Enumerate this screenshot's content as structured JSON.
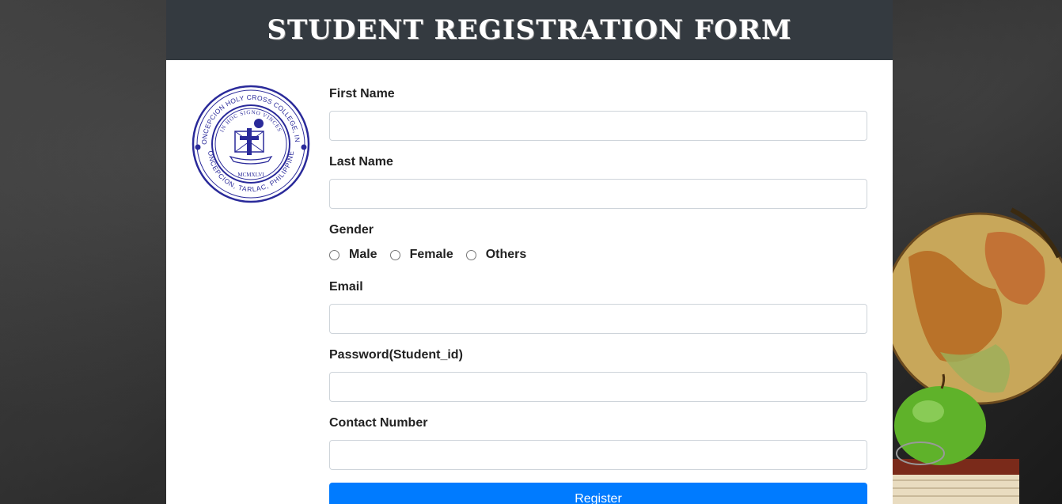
{
  "header": {
    "title": "STUDENT REGISTRATION FORM"
  },
  "logo": {
    "icon": "college-seal-icon",
    "outer_text": "CONCEPCION HOLY CROSS COLLEGE, INC.",
    "inner_text": "IN HOC SIGNO VINCES",
    "bottom_text": "CONCEPCION, TARLAC, PHILIPPINES",
    "year_text": "MCMXLVI",
    "color": "#2a2a9a"
  },
  "form": {
    "first_name": {
      "label": "First Name",
      "value": "",
      "placeholder": ""
    },
    "last_name": {
      "label": "Last Name",
      "value": "",
      "placeholder": ""
    },
    "gender": {
      "label": "Gender",
      "options": [
        "Male",
        "Female",
        "Others"
      ]
    },
    "email": {
      "label": "Email",
      "value": "",
      "placeholder": ""
    },
    "password": {
      "label": "Password(Student_id)",
      "value": "",
      "placeholder": ""
    },
    "contact": {
      "label": "Contact Number",
      "value": "",
      "placeholder": ""
    },
    "submit_label": "Register"
  },
  "colors": {
    "header_bg": "#343a40",
    "button": "#007bff",
    "background": "#2b2b2b"
  },
  "decoration": {
    "icons": [
      "globe-icon",
      "apple-icon",
      "books-icon",
      "glasses-icon"
    ]
  }
}
